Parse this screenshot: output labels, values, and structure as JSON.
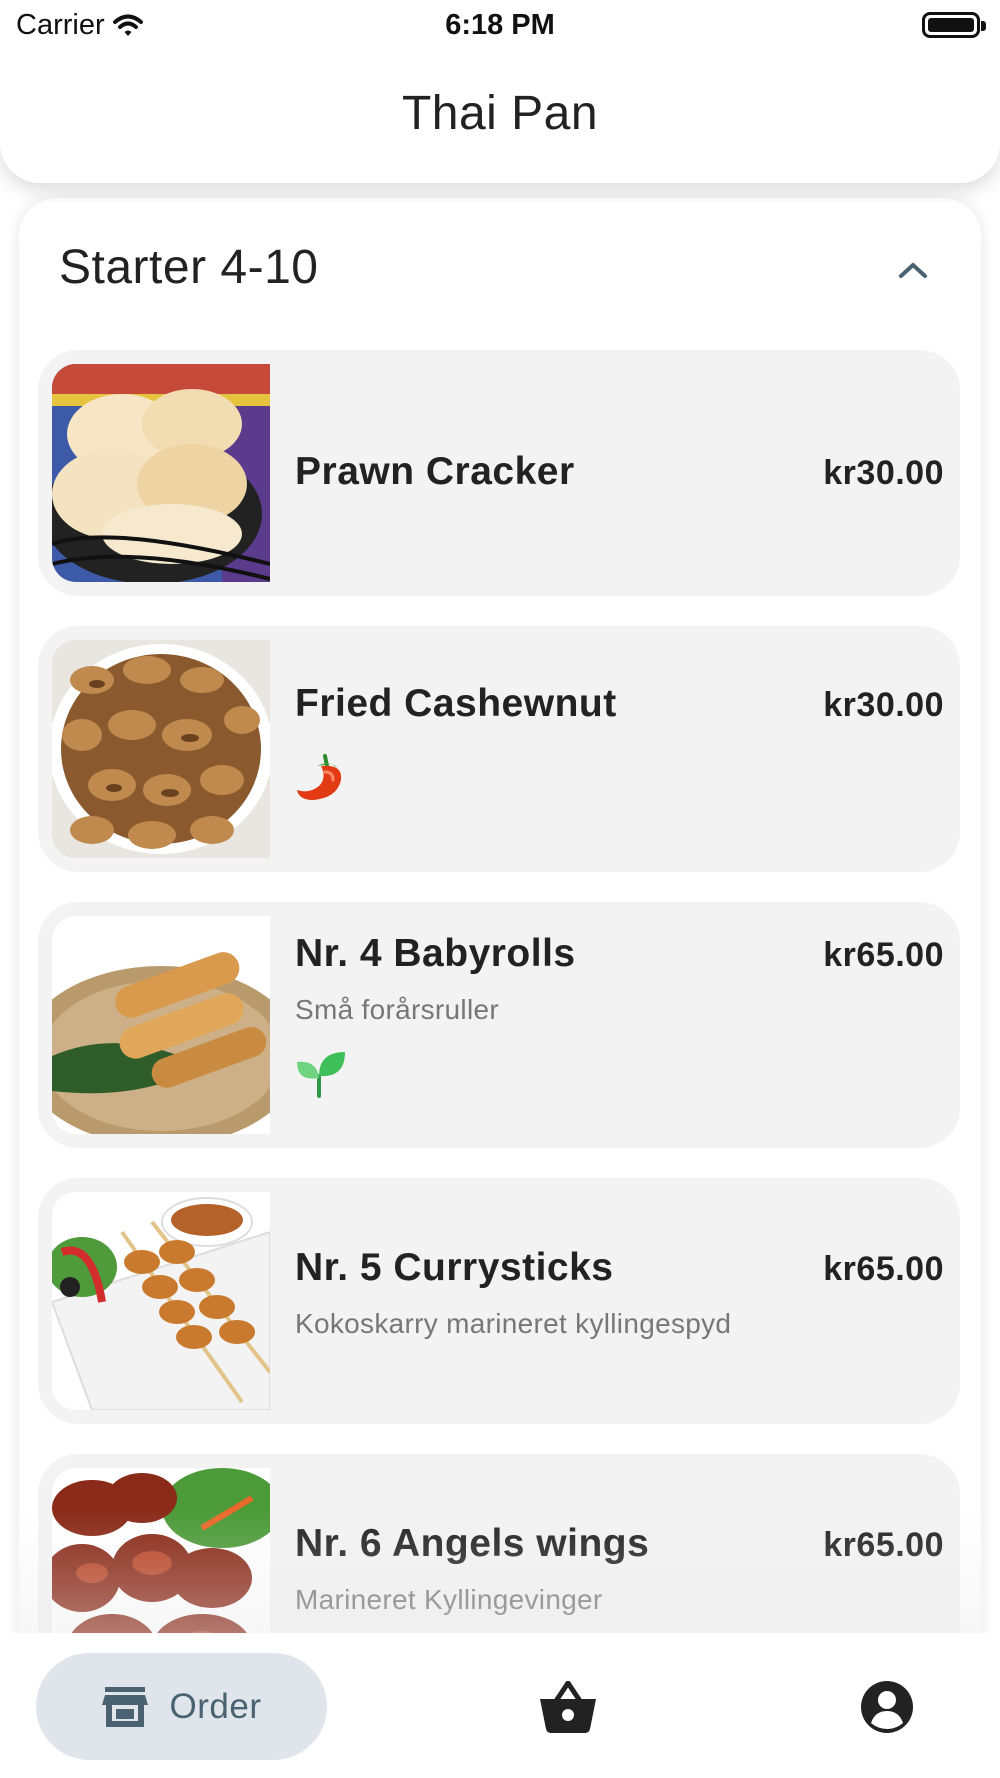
{
  "status_bar": {
    "carrier": "Carrier",
    "time": "6:18 PM",
    "wifi_icon": "wifi-icon",
    "battery_icon": "battery-icon",
    "battery_level": 1.0
  },
  "header": {
    "title": "Thai Pan"
  },
  "section": {
    "title": "Starter 4-10",
    "collapse_icon": "chevron-up-icon",
    "items": [
      {
        "name": "Prawn Cracker",
        "price": "kr30.00",
        "description": "",
        "badge": "",
        "image": "prawn-cracker-photo"
      },
      {
        "name": "Fried Cashewnut",
        "price": "kr30.00",
        "description": "",
        "badge": "chili-pepper-icon",
        "image": "fried-cashewnut-photo"
      },
      {
        "name": "Nr. 4 Babyrolls",
        "price": "kr65.00",
        "description": "Små forårsruller",
        "badge": "leaf-icon",
        "image": "babyrolls-photo"
      },
      {
        "name": "Nr. 5 Currysticks",
        "price": "kr65.00",
        "description": "Kokoskarry marineret kyllingespyd",
        "badge": "",
        "image": "currysticks-photo"
      },
      {
        "name": "Nr. 6 Angels wings",
        "price": "kr65.00",
        "description": "Marineret Kyllingevinger",
        "badge": "",
        "image": "angels-wings-photo"
      }
    ]
  },
  "bottom_nav": {
    "order_label": "Order",
    "order_icon": "store-icon",
    "basket_icon": "basket-icon",
    "profile_icon": "account-circle-icon",
    "active": "Order"
  },
  "colors": {
    "card_bg": "#f3f3f3",
    "active_pill": "#dfe5ea",
    "active_text": "#4a6272",
    "chevron": "#4a6272",
    "chili": "#e23b14",
    "leaf": "#3fbf5a"
  }
}
